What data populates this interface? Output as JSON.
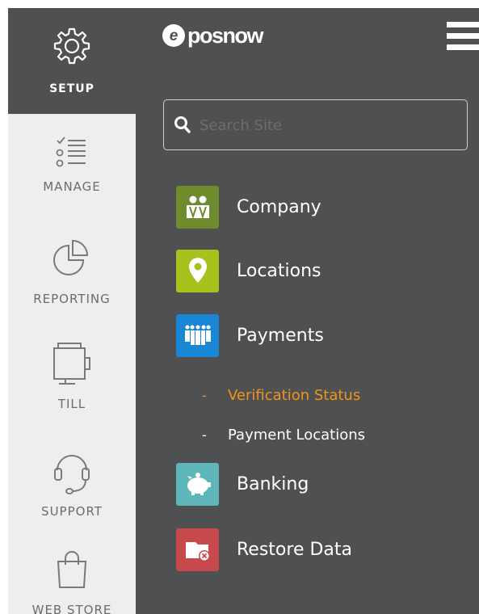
{
  "rail": {
    "items": [
      {
        "label": "SETUP",
        "icon": "gear-icon",
        "active": true
      },
      {
        "label": "MANAGE",
        "icon": "checklist-icon"
      },
      {
        "label": "REPORTING",
        "icon": "pie-chart-icon"
      },
      {
        "label": "TILL",
        "icon": "till-icon"
      },
      {
        "label": "SUPPORT",
        "icon": "headset-icon"
      },
      {
        "label": "WEB STORE",
        "icon": "shopping-bag-icon"
      }
    ]
  },
  "header": {
    "logo_text": "posnow",
    "logo_letter": "e"
  },
  "search": {
    "placeholder": "Search Site",
    "value": ""
  },
  "menu": {
    "items": [
      {
        "label": "Company",
        "icon": "people-icon",
        "color": "#6e8b2e"
      },
      {
        "label": "Locations",
        "icon": "map-pin-icon",
        "color": "#a9c11d"
      },
      {
        "label": "Payments",
        "icon": "crowd-icon",
        "color": "#1a86d6"
      },
      {
        "label": "Banking",
        "icon": "piggy-bank-icon",
        "color": "#5fb6b8"
      },
      {
        "label": "Restore Data",
        "icon": "restore-folder-icon",
        "color": "#c8494b"
      }
    ],
    "sub_items": [
      {
        "label": "Verification Status",
        "dash": "-",
        "color": "#f0941a"
      },
      {
        "label": "Payment Locations",
        "dash": "-",
        "color": "#ffffff"
      }
    ]
  },
  "colors": {
    "panel_bg": "#4f5052",
    "rail_bg": "#eeeeee",
    "accent_orange": "#f0941a"
  }
}
